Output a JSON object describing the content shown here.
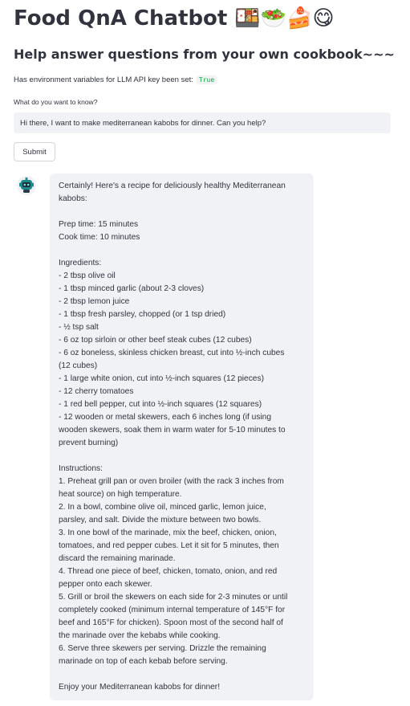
{
  "header": {
    "title": "Food QnA Chatbot 🍱🥗🍰😋",
    "subtitle": "Help answer questions from your own cookbook~~~"
  },
  "env": {
    "label": "Has environment variables for LLM API key been set:",
    "value": "True"
  },
  "question": {
    "label": "What do you want to know?",
    "value": "Hi there, I want to make mediterranean kabobs for dinner. Can you help?"
  },
  "submit_label": "Submit",
  "response": {
    "lines": [
      "Certainly! Here's a recipe for deliciously healthy Mediterranean",
      "kabobs:",
      "",
      "Prep time: 15 minutes",
      "Cook time: 10 minutes",
      "",
      "Ingredients:",
      "- 2 tbsp olive oil",
      "- 1 tbsp minced garlic (about 2-3 cloves)",
      "- 2 tbsp lemon juice",
      "- 1 tbsp fresh parsley, chopped (or 1 tsp dried)",
      "- ½ tsp salt",
      "- 6 oz top sirloin or other beef steak cubes (12 cubes)",
      "- 6 oz boneless, skinless chicken breast, cut into ½-inch cubes",
      "(12 cubes)",
      "- 1 large white onion, cut into ½-inch squares (12 pieces)",
      "- 12 cherry tomatoes",
      "- 1 red bell pepper, cut into ½-inch squares (12 squares)",
      "- 12 wooden or metal skewers, each 6 inches long (if using",
      "wooden skewers, soak them in warm water for 5-10 minutes to",
      "prevent burning)",
      "",
      "Instructions:",
      "1. Preheat grill pan or oven broiler (with the rack 3 inches from",
      "heat source) on high temperature.",
      "2. In a bowl, combine olive oil, minced garlic, lemon juice,",
      "parsley, and salt. Divide the mixture between two bowls.",
      "3. In one bowl of the marinade, mix the beef, chicken, onion,",
      "tomatoes, and red pepper cubes. Let it sit for 5 minutes, then",
      "discard the remaining marinade.",
      "4. Thread one piece of beef, chicken, tomato, onion, and red",
      "pepper onto each skewer.",
      "5. Grill or broil the skewers on each side for 2-3 minutes or until",
      "completely cooked (minimum internal temperature of 145°F for",
      "beef and 165°F for chicken). Spoon most of the second half of",
      "the marinade over the kebabs while cooking.",
      "6. Serve three skewers per serving. Drizzle the remaining",
      "marinade on top of each kebab before serving.",
      "",
      "Enjoy your Mediterranean kabobs for dinner!"
    ]
  },
  "colors": {
    "text": "#31333f",
    "input_bg": "#f0f2f6",
    "code_green": "#09ab3b",
    "avatar_teal": "#1c8a8c"
  },
  "icons": {
    "avatar": "robot-icon"
  }
}
